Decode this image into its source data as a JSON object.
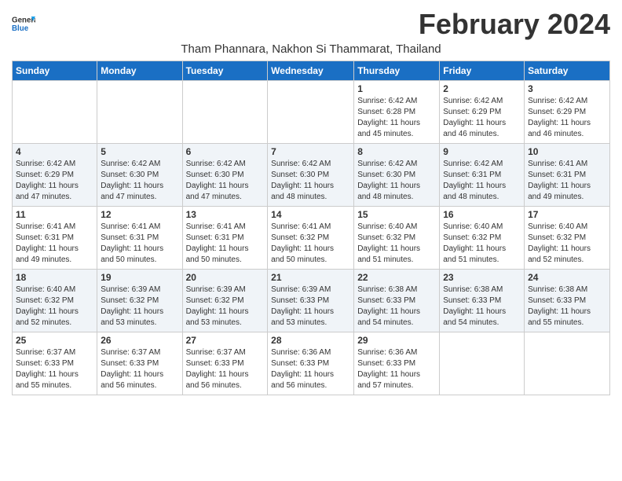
{
  "logo": {
    "line1": "General",
    "line2": "Blue"
  },
  "title": "February 2024",
  "subtitle": "Tham Phannara, Nakhon Si Thammarat, Thailand",
  "days_of_week": [
    "Sunday",
    "Monday",
    "Tuesday",
    "Wednesday",
    "Thursday",
    "Friday",
    "Saturday"
  ],
  "weeks": [
    [
      {
        "num": "",
        "info": ""
      },
      {
        "num": "",
        "info": ""
      },
      {
        "num": "",
        "info": ""
      },
      {
        "num": "",
        "info": ""
      },
      {
        "num": "1",
        "info": "Sunrise: 6:42 AM\nSunset: 6:28 PM\nDaylight: 11 hours\nand 45 minutes."
      },
      {
        "num": "2",
        "info": "Sunrise: 6:42 AM\nSunset: 6:29 PM\nDaylight: 11 hours\nand 46 minutes."
      },
      {
        "num": "3",
        "info": "Sunrise: 6:42 AM\nSunset: 6:29 PM\nDaylight: 11 hours\nand 46 minutes."
      }
    ],
    [
      {
        "num": "4",
        "info": "Sunrise: 6:42 AM\nSunset: 6:29 PM\nDaylight: 11 hours\nand 47 minutes."
      },
      {
        "num": "5",
        "info": "Sunrise: 6:42 AM\nSunset: 6:30 PM\nDaylight: 11 hours\nand 47 minutes."
      },
      {
        "num": "6",
        "info": "Sunrise: 6:42 AM\nSunset: 6:30 PM\nDaylight: 11 hours\nand 47 minutes."
      },
      {
        "num": "7",
        "info": "Sunrise: 6:42 AM\nSunset: 6:30 PM\nDaylight: 11 hours\nand 48 minutes."
      },
      {
        "num": "8",
        "info": "Sunrise: 6:42 AM\nSunset: 6:30 PM\nDaylight: 11 hours\nand 48 minutes."
      },
      {
        "num": "9",
        "info": "Sunrise: 6:42 AM\nSunset: 6:31 PM\nDaylight: 11 hours\nand 48 minutes."
      },
      {
        "num": "10",
        "info": "Sunrise: 6:41 AM\nSunset: 6:31 PM\nDaylight: 11 hours\nand 49 minutes."
      }
    ],
    [
      {
        "num": "11",
        "info": "Sunrise: 6:41 AM\nSunset: 6:31 PM\nDaylight: 11 hours\nand 49 minutes."
      },
      {
        "num": "12",
        "info": "Sunrise: 6:41 AM\nSunset: 6:31 PM\nDaylight: 11 hours\nand 50 minutes."
      },
      {
        "num": "13",
        "info": "Sunrise: 6:41 AM\nSunset: 6:31 PM\nDaylight: 11 hours\nand 50 minutes."
      },
      {
        "num": "14",
        "info": "Sunrise: 6:41 AM\nSunset: 6:32 PM\nDaylight: 11 hours\nand 50 minutes."
      },
      {
        "num": "15",
        "info": "Sunrise: 6:40 AM\nSunset: 6:32 PM\nDaylight: 11 hours\nand 51 minutes."
      },
      {
        "num": "16",
        "info": "Sunrise: 6:40 AM\nSunset: 6:32 PM\nDaylight: 11 hours\nand 51 minutes."
      },
      {
        "num": "17",
        "info": "Sunrise: 6:40 AM\nSunset: 6:32 PM\nDaylight: 11 hours\nand 52 minutes."
      }
    ],
    [
      {
        "num": "18",
        "info": "Sunrise: 6:40 AM\nSunset: 6:32 PM\nDaylight: 11 hours\nand 52 minutes."
      },
      {
        "num": "19",
        "info": "Sunrise: 6:39 AM\nSunset: 6:32 PM\nDaylight: 11 hours\nand 53 minutes."
      },
      {
        "num": "20",
        "info": "Sunrise: 6:39 AM\nSunset: 6:32 PM\nDaylight: 11 hours\nand 53 minutes."
      },
      {
        "num": "21",
        "info": "Sunrise: 6:39 AM\nSunset: 6:33 PM\nDaylight: 11 hours\nand 53 minutes."
      },
      {
        "num": "22",
        "info": "Sunrise: 6:38 AM\nSunset: 6:33 PM\nDaylight: 11 hours\nand 54 minutes."
      },
      {
        "num": "23",
        "info": "Sunrise: 6:38 AM\nSunset: 6:33 PM\nDaylight: 11 hours\nand 54 minutes."
      },
      {
        "num": "24",
        "info": "Sunrise: 6:38 AM\nSunset: 6:33 PM\nDaylight: 11 hours\nand 55 minutes."
      }
    ],
    [
      {
        "num": "25",
        "info": "Sunrise: 6:37 AM\nSunset: 6:33 PM\nDaylight: 11 hours\nand 55 minutes."
      },
      {
        "num": "26",
        "info": "Sunrise: 6:37 AM\nSunset: 6:33 PM\nDaylight: 11 hours\nand 56 minutes."
      },
      {
        "num": "27",
        "info": "Sunrise: 6:37 AM\nSunset: 6:33 PM\nDaylight: 11 hours\nand 56 minutes."
      },
      {
        "num": "28",
        "info": "Sunrise: 6:36 AM\nSunset: 6:33 PM\nDaylight: 11 hours\nand 56 minutes."
      },
      {
        "num": "29",
        "info": "Sunrise: 6:36 AM\nSunset: 6:33 PM\nDaylight: 11 hours\nand 57 minutes."
      },
      {
        "num": "",
        "info": ""
      },
      {
        "num": "",
        "info": ""
      }
    ]
  ]
}
